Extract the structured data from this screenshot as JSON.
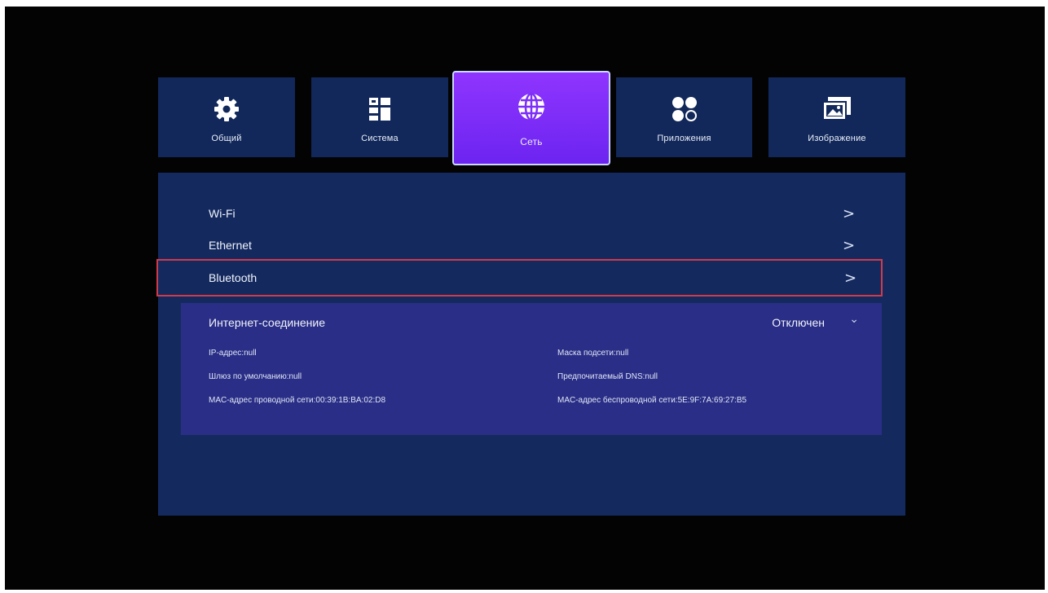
{
  "tabs": [
    {
      "label": "Общий",
      "icon": "gear-icon"
    },
    {
      "label": "Система",
      "icon": "system-grid-icon"
    },
    {
      "label": "Сеть",
      "icon": "globe-icon",
      "active": true
    },
    {
      "label": "Приложения",
      "icon": "apps-icon"
    },
    {
      "label": "Изображение",
      "icon": "image-icon"
    }
  ],
  "menu": [
    {
      "label": "Wi-Fi",
      "chevron": ">"
    },
    {
      "label": "Ethernet",
      "chevron": ">"
    },
    {
      "label": "Bluetooth",
      "chevron": ">",
      "selected": true
    }
  ],
  "connection": {
    "title": "Интернет-соединение",
    "status": "Отключен",
    "dropdown": "⌄"
  },
  "info": {
    "ip": "IP-адрес:null",
    "mask": "Маска подсети:null",
    "gateway": "Шлюз по умолчанию:null",
    "dns": "Предпочитаемый DNS:null",
    "mac_wired": "MAC-адрес проводной сети:00:39:1B:BA:02:D8",
    "mac_wireless": "MAC-адрес беспроводной сети:5E:9F:7A:69:27:B5"
  },
  "colors": {
    "background": "#030304",
    "panel": "#142a5f",
    "tab": "#12285a",
    "active_tab": "#7d2ef7",
    "info_box": "#2a2e86",
    "selection_border": "#d13a4a"
  }
}
